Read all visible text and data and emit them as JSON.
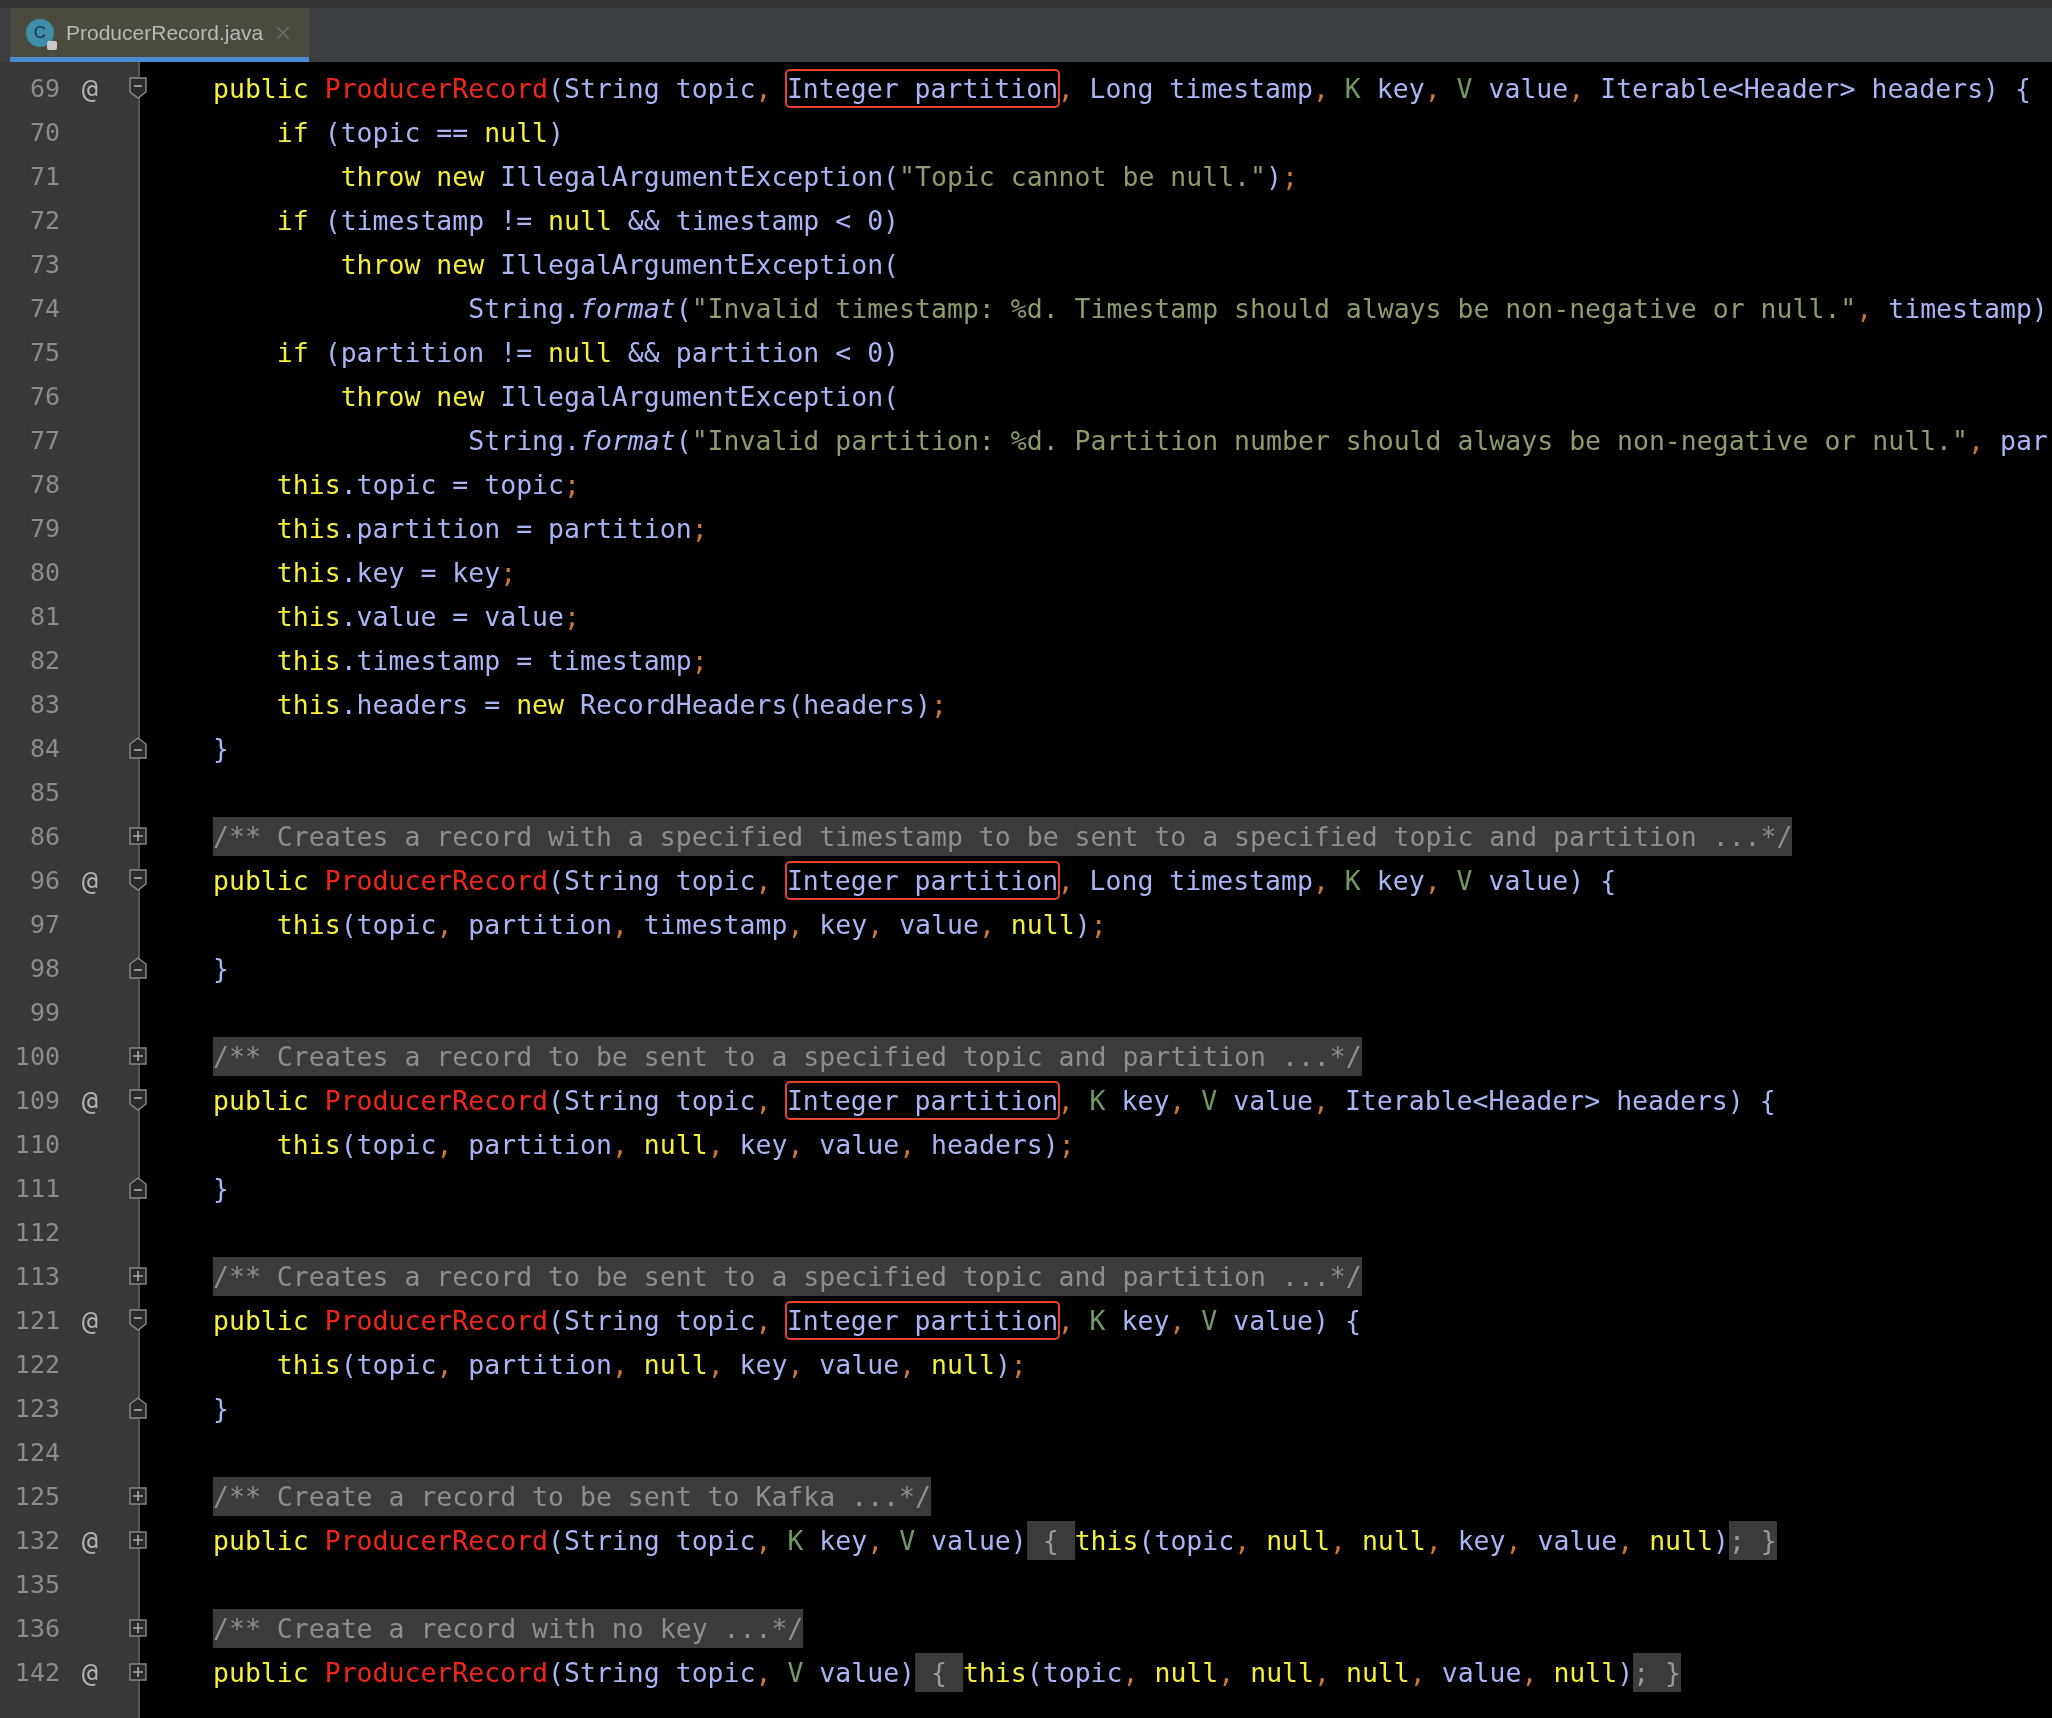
{
  "tab": {
    "icon_letter": "C",
    "title": "ProducerRecord.java",
    "selected": true
  },
  "lines": [
    {
      "num": "69",
      "mark": "@",
      "fold": {
        "kind": "open"
      },
      "tokens": [
        {
          "text": "public ",
          "kind": "k"
        },
        {
          "text": "ProducerRecord",
          "kind": "c"
        },
        {
          "text": "(String topic",
          "kind": "p"
        },
        {
          "text": ", ",
          "kind": "o"
        },
        {
          "text": "Integer partition",
          "kind": "b"
        },
        {
          "text": ",",
          "kind": "o"
        },
        {
          "text": " Long timestamp",
          "kind": "p"
        },
        {
          "text": ", ",
          "kind": "o"
        },
        {
          "text": "K",
          "kind": "t"
        },
        {
          "text": " key",
          "kind": "p"
        },
        {
          "text": ", ",
          "kind": "o"
        },
        {
          "text": "V",
          "kind": "t"
        },
        {
          "text": " value",
          "kind": "p"
        },
        {
          "text": ",",
          "kind": "o"
        },
        {
          "text": " Iterable<Header> headers) {",
          "kind": "p"
        }
      ]
    },
    {
      "num": "70",
      "tokens": [
        {
          "text": "    if",
          "kind": "k"
        },
        {
          "text": " (topic == ",
          "kind": "p"
        },
        {
          "text": "null",
          "kind": "k"
        },
        {
          "text": ")",
          "kind": "p"
        }
      ]
    },
    {
      "num": "71",
      "tokens": [
        {
          "text": "        throw new",
          "kind": "k"
        },
        {
          "text": " IllegalArgumentException(",
          "kind": "p"
        },
        {
          "text": "\"Topic cannot be null.\"",
          "kind": "s"
        },
        {
          "text": ")",
          "kind": "p"
        },
        {
          "text": ";",
          "kind": "o"
        }
      ]
    },
    {
      "num": "72",
      "tokens": [
        {
          "text": "    if",
          "kind": "k"
        },
        {
          "text": " (timestamp != ",
          "kind": "p"
        },
        {
          "text": "null",
          "kind": "k"
        },
        {
          "text": " && timestamp < 0)",
          "kind": "p"
        }
      ]
    },
    {
      "num": "73",
      "tokens": [
        {
          "text": "        throw new",
          "kind": "k"
        },
        {
          "text": " IllegalArgumentException(",
          "kind": "p"
        }
      ]
    },
    {
      "num": "74",
      "tokens": [
        {
          "text": "                String.",
          "kind": "p"
        },
        {
          "text": "format",
          "kind": "i"
        },
        {
          "text": "(",
          "kind": "p"
        },
        {
          "text": "\"Invalid timestamp: %d. Timestamp should always be non-negative or null.\"",
          "kind": "s"
        },
        {
          "text": ",",
          "kind": "o"
        },
        {
          "text": " timestamp)",
          "kind": "p"
        }
      ]
    },
    {
      "num": "75",
      "tokens": [
        {
          "text": "    if",
          "kind": "k"
        },
        {
          "text": " (partition != ",
          "kind": "p"
        },
        {
          "text": "null",
          "kind": "k"
        },
        {
          "text": " && partition < 0)",
          "kind": "p"
        }
      ]
    },
    {
      "num": "76",
      "tokens": [
        {
          "text": "        throw new",
          "kind": "k"
        },
        {
          "text": " IllegalArgumentException(",
          "kind": "p"
        }
      ]
    },
    {
      "num": "77",
      "tokens": [
        {
          "text": "                String.",
          "kind": "p"
        },
        {
          "text": "format",
          "kind": "i"
        },
        {
          "text": "(",
          "kind": "p"
        },
        {
          "text": "\"Invalid partition: %d. Partition number should always be non-negative or null.\"",
          "kind": "s"
        },
        {
          "text": ",",
          "kind": "o"
        },
        {
          "text": " par",
          "kind": "p"
        }
      ]
    },
    {
      "num": "78",
      "tokens": [
        {
          "text": "    this",
          "kind": "k"
        },
        {
          "text": ".topic = topic",
          "kind": "p"
        },
        {
          "text": ";",
          "kind": "o"
        }
      ]
    },
    {
      "num": "79",
      "tokens": [
        {
          "text": "    this",
          "kind": "k"
        },
        {
          "text": ".partition = partition",
          "kind": "p"
        },
        {
          "text": ";",
          "kind": "o"
        }
      ]
    },
    {
      "num": "80",
      "tokens": [
        {
          "text": "    this",
          "kind": "k"
        },
        {
          "text": ".key = key",
          "kind": "p"
        },
        {
          "text": ";",
          "kind": "o"
        }
      ]
    },
    {
      "num": "81",
      "tokens": [
        {
          "text": "    this",
          "kind": "k"
        },
        {
          "text": ".value = value",
          "kind": "p"
        },
        {
          "text": ";",
          "kind": "o"
        }
      ]
    },
    {
      "num": "82",
      "tokens": [
        {
          "text": "    this",
          "kind": "k"
        },
        {
          "text": ".timestamp = timestamp",
          "kind": "p"
        },
        {
          "text": ";",
          "kind": "o"
        }
      ]
    },
    {
      "num": "83",
      "tokens": [
        {
          "text": "    this",
          "kind": "k"
        },
        {
          "text": ".headers = ",
          "kind": "p"
        },
        {
          "text": "new",
          "kind": "k"
        },
        {
          "text": " RecordHeaders(headers)",
          "kind": "p"
        },
        {
          "text": ";",
          "kind": "o"
        }
      ]
    },
    {
      "num": "84",
      "fold": {
        "kind": "close"
      },
      "tokens": [
        {
          "text": "}",
          "kind": "p"
        }
      ]
    },
    {
      "num": "85"
    },
    {
      "num": "86",
      "fold": {
        "kind": "collapsed"
      },
      "tokens": [
        {
          "text": "/** Creates a record with a specified timestamp to be sent to a specified topic and partition ...*/",
          "kind": "m"
        }
      ]
    },
    {
      "num": "96",
      "mark": "@",
      "fold": {
        "kind": "open"
      },
      "tokens": [
        {
          "text": "public ",
          "kind": "k"
        },
        {
          "text": "ProducerRecord",
          "kind": "c"
        },
        {
          "text": "(String topic",
          "kind": "p"
        },
        {
          "text": ", ",
          "kind": "o"
        },
        {
          "text": "Integer partition",
          "kind": "b"
        },
        {
          "text": ",",
          "kind": "o"
        },
        {
          "text": " Long timestamp",
          "kind": "p"
        },
        {
          "text": ", ",
          "kind": "o"
        },
        {
          "text": "K",
          "kind": "t"
        },
        {
          "text": " key",
          "kind": "p"
        },
        {
          "text": ", ",
          "kind": "o"
        },
        {
          "text": "V",
          "kind": "t"
        },
        {
          "text": " value) {",
          "kind": "p"
        }
      ]
    },
    {
      "num": "97",
      "tokens": [
        {
          "text": "    this",
          "kind": "k"
        },
        {
          "text": "(topic",
          "kind": "p"
        },
        {
          "text": ",",
          "kind": "o"
        },
        {
          "text": " partition",
          "kind": "p"
        },
        {
          "text": ",",
          "kind": "o"
        },
        {
          "text": " timestamp",
          "kind": "p"
        },
        {
          "text": ",",
          "kind": "o"
        },
        {
          "text": " key",
          "kind": "p"
        },
        {
          "text": ",",
          "kind": "o"
        },
        {
          "text": " value",
          "kind": "p"
        },
        {
          "text": ",",
          "kind": "o"
        },
        {
          "text": " null",
          "kind": "k"
        },
        {
          "text": ")",
          "kind": "p"
        },
        {
          "text": ";",
          "kind": "o"
        }
      ]
    },
    {
      "num": "98",
      "fold": {
        "kind": "close"
      },
      "tokens": [
        {
          "text": "}",
          "kind": "p"
        }
      ]
    },
    {
      "num": "99"
    },
    {
      "num": "100",
      "fold": {
        "kind": "collapsed"
      },
      "tokens": [
        {
          "text": "/** Creates a record to be sent to a specified topic and partition ...*/",
          "kind": "m"
        }
      ]
    },
    {
      "num": "109",
      "mark": "@",
      "fold": {
        "kind": "open"
      },
      "tokens": [
        {
          "text": "public ",
          "kind": "k"
        },
        {
          "text": "ProducerRecord",
          "kind": "c"
        },
        {
          "text": "(String topic",
          "kind": "p"
        },
        {
          "text": ", ",
          "kind": "o"
        },
        {
          "text": "Integer partition",
          "kind": "b"
        },
        {
          "text": ", ",
          "kind": "o"
        },
        {
          "text": "K",
          "kind": "t"
        },
        {
          "text": " key",
          "kind": "p"
        },
        {
          "text": ", ",
          "kind": "o"
        },
        {
          "text": "V",
          "kind": "t"
        },
        {
          "text": " value",
          "kind": "p"
        },
        {
          "text": ",",
          "kind": "o"
        },
        {
          "text": " Iterable<Header> headers) {",
          "kind": "p"
        }
      ]
    },
    {
      "num": "110",
      "tokens": [
        {
          "text": "    this",
          "kind": "k"
        },
        {
          "text": "(topic",
          "kind": "p"
        },
        {
          "text": ",",
          "kind": "o"
        },
        {
          "text": " partition",
          "kind": "p"
        },
        {
          "text": ",",
          "kind": "o"
        },
        {
          "text": " null",
          "kind": "k"
        },
        {
          "text": ",",
          "kind": "o"
        },
        {
          "text": " key",
          "kind": "p"
        },
        {
          "text": ",",
          "kind": "o"
        },
        {
          "text": " value",
          "kind": "p"
        },
        {
          "text": ",",
          "kind": "o"
        },
        {
          "text": " headers)",
          "kind": "p"
        },
        {
          "text": ";",
          "kind": "o"
        }
      ]
    },
    {
      "num": "111",
      "fold": {
        "kind": "close"
      },
      "tokens": [
        {
          "text": "}",
          "kind": "p"
        }
      ]
    },
    {
      "num": "112"
    },
    {
      "num": "113",
      "fold": {
        "kind": "collapsed"
      },
      "tokens": [
        {
          "text": "/** Creates a record to be sent to a specified topic and partition ...*/",
          "kind": "m"
        }
      ]
    },
    {
      "num": "121",
      "mark": "@",
      "fold": {
        "kind": "open"
      },
      "tokens": [
        {
          "text": "public ",
          "kind": "k"
        },
        {
          "text": "ProducerRecord",
          "kind": "c"
        },
        {
          "text": "(String topic",
          "kind": "p"
        },
        {
          "text": ", ",
          "kind": "o"
        },
        {
          "text": "Integer partition",
          "kind": "b"
        },
        {
          "text": ", ",
          "kind": "o"
        },
        {
          "text": "K",
          "kind": "t"
        },
        {
          "text": " key",
          "kind": "p"
        },
        {
          "text": ", ",
          "kind": "o"
        },
        {
          "text": "V",
          "kind": "t"
        },
        {
          "text": " value) {",
          "kind": "p"
        }
      ]
    },
    {
      "num": "122",
      "tokens": [
        {
          "text": "    this",
          "kind": "k"
        },
        {
          "text": "(topic",
          "kind": "p"
        },
        {
          "text": ",",
          "kind": "o"
        },
        {
          "text": " partition",
          "kind": "p"
        },
        {
          "text": ",",
          "kind": "o"
        },
        {
          "text": " null",
          "kind": "k"
        },
        {
          "text": ",",
          "kind": "o"
        },
        {
          "text": " key",
          "kind": "p"
        },
        {
          "text": ",",
          "kind": "o"
        },
        {
          "text": " value",
          "kind": "p"
        },
        {
          "text": ",",
          "kind": "o"
        },
        {
          "text": " null",
          "kind": "k"
        },
        {
          "text": ")",
          "kind": "p"
        },
        {
          "text": ";",
          "kind": "o"
        }
      ]
    },
    {
      "num": "123",
      "fold": {
        "kind": "close"
      },
      "tokens": [
        {
          "text": "}",
          "kind": "p"
        }
      ]
    },
    {
      "num": "124"
    },
    {
      "num": "125",
      "fold": {
        "kind": "collapsed"
      },
      "tokens": [
        {
          "text": "/** Create a record to be sent to Kafka ...*/",
          "kind": "m"
        }
      ]
    },
    {
      "num": "132",
      "mark": "@",
      "fold": {
        "kind": "collapsed"
      },
      "tokens": [
        {
          "text": "public ",
          "kind": "k"
        },
        {
          "text": "ProducerRecord",
          "kind": "c"
        },
        {
          "text": "(String topic",
          "kind": "p"
        },
        {
          "text": ", ",
          "kind": "o"
        },
        {
          "text": "K",
          "kind": "t"
        },
        {
          "text": " key",
          "kind": "p"
        },
        {
          "text": ", ",
          "kind": "o"
        },
        {
          "text": "V",
          "kind": "t"
        },
        {
          "text": " value)",
          "kind": "p"
        },
        {
          "text": " { ",
          "kind": "g"
        },
        {
          "text": "this",
          "kind": "k"
        },
        {
          "text": "(topic",
          "kind": "p"
        },
        {
          "text": ",",
          "kind": "o"
        },
        {
          "text": " null",
          "kind": "k"
        },
        {
          "text": ",",
          "kind": "o"
        },
        {
          "text": " null",
          "kind": "k"
        },
        {
          "text": ",",
          "kind": "o"
        },
        {
          "text": " key",
          "kind": "p"
        },
        {
          "text": ",",
          "kind": "o"
        },
        {
          "text": " value",
          "kind": "p"
        },
        {
          "text": ",",
          "kind": "o"
        },
        {
          "text": " null",
          "kind": "k"
        },
        {
          "text": ")",
          "kind": "p"
        },
        {
          "text": "; }",
          "kind": "g"
        }
      ]
    },
    {
      "num": "135"
    },
    {
      "num": "136",
      "fold": {
        "kind": "collapsed"
      },
      "tokens": [
        {
          "text": "/** Create a record with no key ...*/",
          "kind": "m"
        }
      ]
    },
    {
      "num": "142",
      "mark": "@",
      "fold": {
        "kind": "collapsed"
      },
      "tokens": [
        {
          "text": "public ",
          "kind": "k"
        },
        {
          "text": "ProducerRecord",
          "kind": "c"
        },
        {
          "text": "(String topic",
          "kind": "p"
        },
        {
          "text": ", ",
          "kind": "o"
        },
        {
          "text": "V",
          "kind": "t"
        },
        {
          "text": " value)",
          "kind": "p"
        },
        {
          "text": " { ",
          "kind": "g"
        },
        {
          "text": "this",
          "kind": "k"
        },
        {
          "text": "(topic",
          "kind": "p"
        },
        {
          "text": ",",
          "kind": "o"
        },
        {
          "text": " null",
          "kind": "k"
        },
        {
          "text": ",",
          "kind": "o"
        },
        {
          "text": " null",
          "kind": "k"
        },
        {
          "text": ",",
          "kind": "o"
        },
        {
          "text": " null",
          "kind": "k"
        },
        {
          "text": ",",
          "kind": "o"
        },
        {
          "text": " value",
          "kind": "p"
        },
        {
          "text": ",",
          "kind": "o"
        },
        {
          "text": " null",
          "kind": "k"
        },
        {
          "text": ")",
          "kind": "p"
        },
        {
          "text": "; }",
          "kind": "g"
        }
      ]
    }
  ]
}
